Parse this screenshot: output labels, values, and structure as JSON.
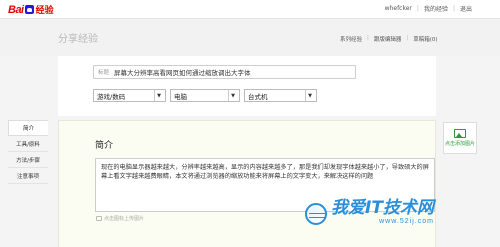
{
  "header": {
    "logo_text_bai": "Bai",
    "logo_text_jingyan": "经验",
    "username": "whefcker",
    "my_experience": "我的经验",
    "logout": "退出"
  },
  "subheader": {
    "page_title": "分享经验",
    "links": [
      "系列经验",
      "跟版编辑器",
      "草稿箱(0)"
    ]
  },
  "form": {
    "title_label": "标题",
    "title_value": "屏幕大分辨率高看网页如何通过缩放调出大字体",
    "category_1": "游戏/数码",
    "category_2": "电脑",
    "category_3": "台式机"
  },
  "sidebar": {
    "items": [
      "简介",
      "工具/原料",
      "方法/步骤",
      "注意事项"
    ]
  },
  "intro": {
    "section_title": "简介",
    "content": "现在的电脑显示器越来越大，分辨率越来越高，显示的内容越来越多了，那是我们却发现字体越来越小了，导致硕大的屏幕上看文字越来越费眼睛，本文将通过浏览器的缩放功能来将屏幕上的文字变大，来解决这样的问题",
    "upload_hint": "点击图标上传图片"
  },
  "right_panel": {
    "add_image_label": "点击添加图片"
  },
  "watermark": {
    "main": "我爱IT技术网",
    "sub": "www.52ij.com"
  },
  "colors": {
    "baidu_red": "#e10602",
    "baidu_blue": "#2319dc",
    "watermark_blue": "#2a8fd8",
    "upload_green": "#2d9a3a"
  }
}
